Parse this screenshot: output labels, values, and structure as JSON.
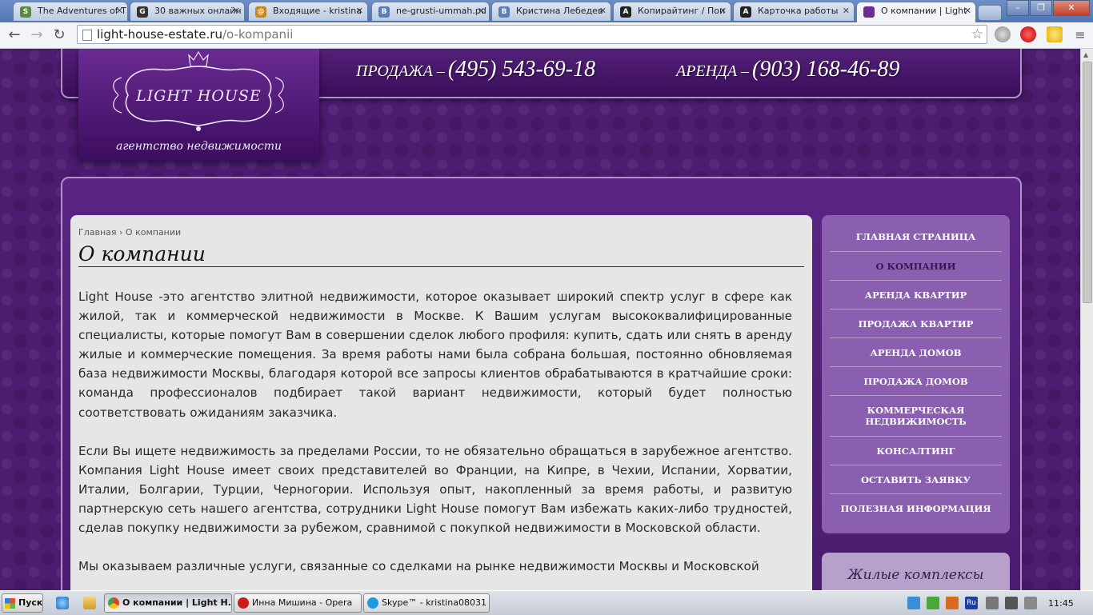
{
  "browser": {
    "tabs": [
      {
        "label": "The Adventures of T",
        "favicon": "S",
        "color": "#5a8a3c"
      },
      {
        "label": "30 важных онлайн",
        "favicon": "G",
        "color": "#333333"
      },
      {
        "label": "Входящие - kristina",
        "favicon": "@",
        "color": "#c8861e"
      },
      {
        "label": "ne-grusti-ummah.pd",
        "favicon": "B",
        "color": "#5a7fb8"
      },
      {
        "label": "Кристина Лебедев",
        "favicon": "B",
        "color": "#5a7fb8"
      },
      {
        "label": "Копирайтинг / Пои",
        "favicon": "A",
        "color": "#222222"
      },
      {
        "label": "Карточка работы",
        "favicon": "A",
        "color": "#222222"
      },
      {
        "label": "О компании | Light",
        "favicon": "",
        "color": "#6a2b93"
      }
    ],
    "url_host": "light-house-estate.ru",
    "url_path": "/o-kompanii"
  },
  "site": {
    "logo_name": "LIGHT HOUSE",
    "logo_sub": "агентство недвижимости",
    "sale_label": "ПРОДАЖА –",
    "sale_phone": "(495) 543-69-18",
    "rent_label": "АРЕНДА –",
    "rent_phone": "(903) 168-46-89"
  },
  "content": {
    "breadcrumb_home": "Главная",
    "breadcrumb_sep": "›",
    "breadcrumb_current": "О компании",
    "title": "О компании",
    "paragraphs": [
      "Light House -это агентство элитной недвижимости, которое оказывает широкий спектр услуг в сфере как жилой, так и коммерческой недвижимости в Москве. К Вашим услугам высококвалифицированные специалисты, которые помогут Вам в совершении сделок любого профиля: купить, сдать или снять в аренду жилые и коммерческие помещения. За время работы нами была собрана большая, постоянно обновляемая база недвижимости Москвы, благодаря которой все запросы клиентов обрабатываются в кратчайшие сроки: команда профессионалов подбирает такой вариант недвижимости, который будет полностью соответствовать ожиданиям заказчика.",
      "Если Вы ищете недвижимость за пределами России, то не обязательно обращаться в зарубежное агентство. Компания Light House имеет своих представителей во Франции, на Кипре, в Чехии, Испании, Хорватии, Италии, Болгарии, Турции, Черногории. Используя опыт, накопленный за время работы, и развитую партнерскую сеть нашего агентства, сотрудники Light House помогут Вам избежать каких-либо трудностей, сделав покупку недвижимости за рубежом, сравнимой с покупкой недвижимости в Московской области.",
      "Мы оказываем различные услуги, связанные со сделками на рынке недвижимости Москвы и Московской"
    ]
  },
  "menu": [
    {
      "label": "ГЛАВНАЯ СТРАНИЦА"
    },
    {
      "label": "О КОМПАНИИ"
    },
    {
      "label": "АРЕНДА КВАРТИР"
    },
    {
      "label": "ПРОДАЖА КВАРТИР"
    },
    {
      "label": "АРЕНДА ДОМОВ"
    },
    {
      "label": "ПРОДАЖА ДОМОВ"
    },
    {
      "label": "КОММЕРЧЕСКАЯ НЕДВИЖИМОСТЬ"
    },
    {
      "label": "КОНСАЛТИНГ"
    },
    {
      "label": "ОСТАВИТЬ ЗАЯВКУ"
    },
    {
      "label": "ПОЛЕЗНАЯ ИНФОРМАЦИЯ"
    }
  ],
  "menu_current": "О КОМПАНИИ",
  "complex_title": "Жилые комплексы",
  "taskbar": {
    "start_label": "Пуск",
    "tasks": [
      {
        "label": "О компании | Light H...",
        "color": "#d8452c"
      },
      {
        "label": "Инна Мишина - Opera",
        "color": "#cc1b1b"
      },
      {
        "label": "Skype™ - kristina08031",
        "color": "#1e9be0"
      }
    ],
    "lang": "Ru",
    "time": "11:45"
  }
}
